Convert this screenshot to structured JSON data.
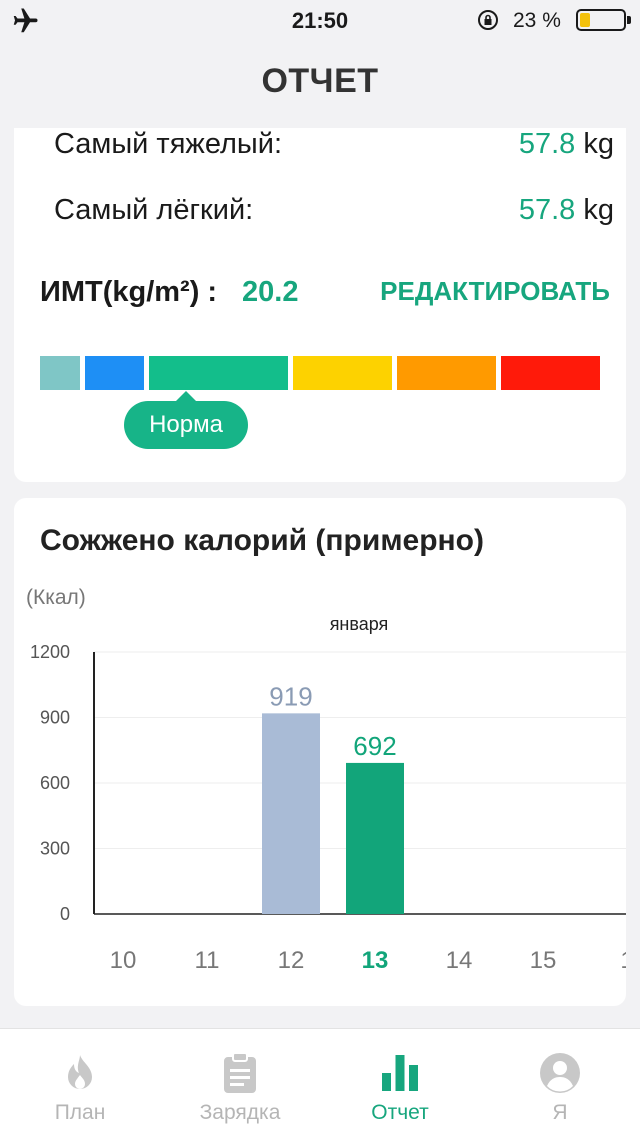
{
  "status_bar": {
    "time": "21:50",
    "battery_pct_text": "23 %",
    "battery_level": 0.23,
    "icons": [
      "airplane-icon",
      "rotation-lock-icon",
      "battery-icon"
    ]
  },
  "header": {
    "title": "ОТЧЕТ"
  },
  "weight_card": {
    "heaviest_label": "Самый тяжелый:",
    "heaviest_value": "57.8",
    "heaviest_unit": "kg",
    "lightest_label": "Самый лёгкий:",
    "lightest_value": "57.8",
    "lightest_unit": "kg",
    "bmi_label": "ИМТ(kg/m²) :",
    "bmi_value": "20.2",
    "edit_label": "РЕДАКТИРОВАТЬ",
    "bmi_scale_colors": [
      "#7fc6c6",
      "#1e8ff5",
      "#13be8b",
      "#fdd200",
      "#ff9a00",
      "#ff1a0a"
    ],
    "bmi_status": "Норма",
    "bmi_status_color": "#17b488"
  },
  "calories_card": {
    "title": "Сожжено калорий (примерно)",
    "unit": "(Ккал)"
  },
  "chart_data": {
    "type": "bar",
    "title": "Сожжено калорий (примерно)",
    "ylabel": "(Ккал)",
    "month_label": "января",
    "categories": [
      "10",
      "11",
      "12",
      "13",
      "14",
      "15",
      "1"
    ],
    "values": [
      null,
      null,
      919,
      692,
      null,
      null,
      null
    ],
    "value_labels": [
      "",
      "",
      "919",
      "692",
      "",
      "",
      ""
    ],
    "highlight_category": "13",
    "ylim": [
      0,
      1200
    ],
    "yticks": [
      0,
      300,
      600,
      900,
      1200
    ],
    "bar_colors": [
      "#a9bbd6",
      "#a9bbd6",
      "#a9bbd6",
      "#12a57a",
      "#a9bbd6",
      "#a9bbd6",
      "#a9bbd6"
    ],
    "label_colors": [
      "#8a9bb4",
      "#8a9bb4",
      "#8a9bb4",
      "#12a57a",
      "#8a9bb4",
      "#8a9bb4",
      "#8a9bb4"
    ],
    "grid": true
  },
  "tabbar": {
    "items": [
      {
        "label": "План",
        "icon": "flame-icon",
        "active": false
      },
      {
        "label": "Зарядка",
        "icon": "clipboard-icon",
        "active": false
      },
      {
        "label": "Отчет",
        "icon": "bar-chart-icon",
        "active": true
      },
      {
        "label": "Я",
        "icon": "user-icon",
        "active": false
      }
    ],
    "active_color": "#17a67e",
    "inactive_color": "#b5b5b5"
  }
}
